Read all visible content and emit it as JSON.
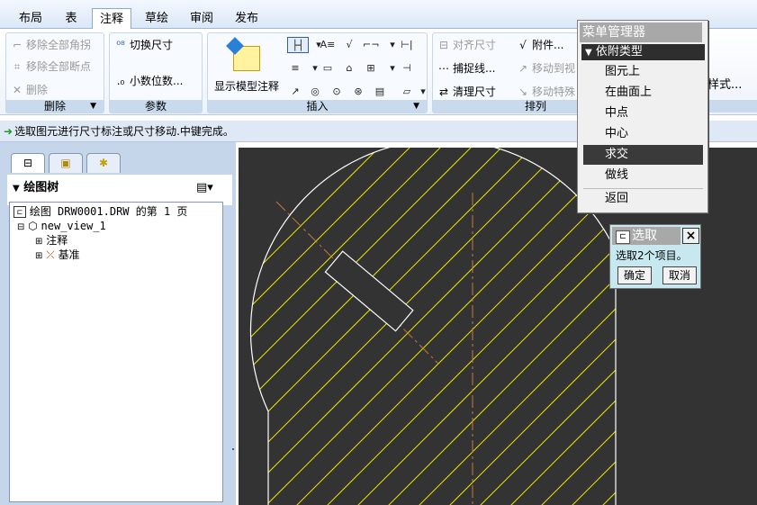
{
  "tabs": [
    "布局",
    "表",
    "注释",
    "草绘",
    "审阅",
    "发布"
  ],
  "active_tab": "注释",
  "ribbon": {
    "delete_group": {
      "title": "删除",
      "items": [
        "移除全部角拐",
        "移除全部断点",
        "删除"
      ]
    },
    "params_group": {
      "title": "参数",
      "items": [
        "切换尺寸",
        "小数位数..."
      ]
    },
    "insert_group": {
      "title": "插入",
      "show_model_annotations": "显示模型注释"
    },
    "arrange_group": {
      "title": "排列",
      "items": [
        "对齐尺寸",
        "捕捉线...",
        "清理尺寸",
        "附件...",
        "移动到视",
        "移动特殊"
      ]
    },
    "partial_right_label": "样式..."
  },
  "status_message": "选取图元进行尺寸标注或尺寸移动.中键完成。",
  "drawing_tree": {
    "title": "绘图树",
    "root": "绘图 DRW0001.DRW 的第 1 页",
    "view": "new_view_1",
    "children": [
      "注释",
      "基准"
    ]
  },
  "menu_manager": {
    "title": "菜单管理器",
    "header": "依附类型",
    "items": [
      "图元上",
      "在曲面上",
      "中点",
      "中心",
      "求交",
      "做线"
    ],
    "selected": "求交",
    "return_label": "返回"
  },
  "select_dialog": {
    "title": "选取",
    "message": "选取2个项目。",
    "ok": "确定",
    "cancel": "取消"
  },
  "colors": {
    "canvas_bg": "#333333",
    "hatch": "#e6e600",
    "centerline": "#c8783c",
    "geometry": "#ffffff"
  }
}
